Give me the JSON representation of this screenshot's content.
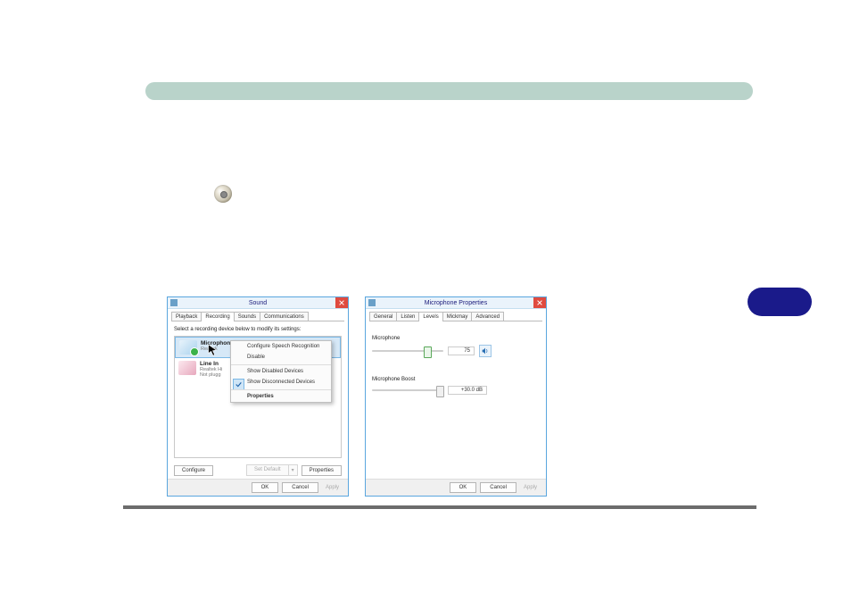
{
  "sound": {
    "title": "Sound",
    "tabs": [
      "Playback",
      "Recording",
      "Sounds",
      "Communications"
    ],
    "active_tab": 1,
    "instruction": "Select a recording device below to modify its settings:",
    "devices": [
      {
        "name": "Microphone",
        "sub1": "Realtek",
        "selected": true
      },
      {
        "name": "Line In",
        "sub1": "Realtek Hi",
        "sub2": "Not plugg"
      }
    ],
    "context_menu": {
      "items": [
        {
          "label": "Configure Speech Recognition"
        },
        {
          "label": "Disable"
        },
        {
          "label": "Show Disabled Devices",
          "sep": true
        },
        {
          "label": "Show Disconnected Devices",
          "checked": true
        },
        {
          "label": "Properties",
          "bold": true,
          "sep": true
        }
      ]
    },
    "buttons": {
      "configure": "Configure",
      "set_default": "Set Default",
      "properties": "Properties",
      "ok": "OK",
      "cancel": "Cancel",
      "apply": "Apply"
    }
  },
  "micprops": {
    "title": "Microphone Properties",
    "tabs": [
      "General",
      "Listen",
      "Levels",
      "Mickmay",
      "Advanced"
    ],
    "active_tab": 2,
    "levels": {
      "mic_label": "Microphone",
      "mic_value": "75",
      "boost_label": "Microphone Boost",
      "boost_value": "+30.0 dB"
    },
    "buttons": {
      "ok": "OK",
      "cancel": "Cancel",
      "apply": "Apply"
    }
  }
}
